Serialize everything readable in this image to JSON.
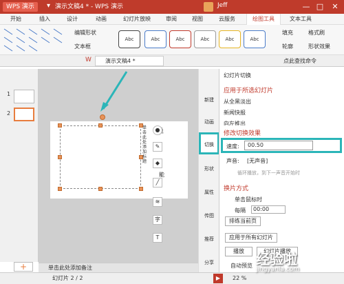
{
  "titlebar": {
    "logo": "WPS 演示",
    "doc_title": "演示文稿4 * - WPS 演示",
    "user": "Jeff",
    "minimize": "—",
    "maximize": "□",
    "close": "✕"
  },
  "menu": [
    "开始",
    "插入",
    "设计",
    "动画",
    "幻灯片放映",
    "审阅",
    "视图",
    "云服务",
    "绘图工具",
    "文本工具"
  ],
  "ribbon": {
    "edit_shape": "编辑形状",
    "textbox": "文本框",
    "style_label": "Abc",
    "fill": "填充",
    "format_brush": "格式刷",
    "outline": "轮廓",
    "shape_effect": "形状效果"
  },
  "tab": {
    "doc": "演示文稿4 *",
    "hint": "点此查找命令"
  },
  "thumbs": [
    "1",
    "2"
  ],
  "slide_text": {
    "title_char": "单",
    "vert_text": "单击此处添加标题",
    "fragment": "能"
  },
  "sidenav": [
    "新建",
    "动画",
    "切换",
    "形状",
    "属性",
    "传图",
    "推荐",
    "分享"
  ],
  "taskpane": {
    "title": "幻灯片切换",
    "apply_selected": "应用于所选幻灯片",
    "effects": [
      "从全黑淡出",
      "新闻快报",
      "向左推出"
    ],
    "modify": "修改切换效果",
    "speed_label": "速度:",
    "speed_value": "00.50",
    "sound_label": "声音:",
    "sound_value": "[无声音]",
    "loop_label": "循环播放，到下一声音开始时",
    "change_mode": "换片方式",
    "on_click": "单击鼠标时",
    "every": "每隔",
    "every_value": "00:00",
    "rehearse": "排练当前页",
    "apply_all": "应用于所有幻灯片",
    "play": "播放",
    "slideshow": "幻灯片播放",
    "autopreview": "自动预览"
  },
  "notes": "单击此处添加备注",
  "status": {
    "slide": "幻灯片 2 / 2",
    "zoom": "22 %"
  },
  "watermark": {
    "cn": "经验啦",
    "url": "jingyanla.com"
  },
  "colors": {
    "accent_red": "#bf3b2b",
    "highlight": "#2bb5b8"
  }
}
